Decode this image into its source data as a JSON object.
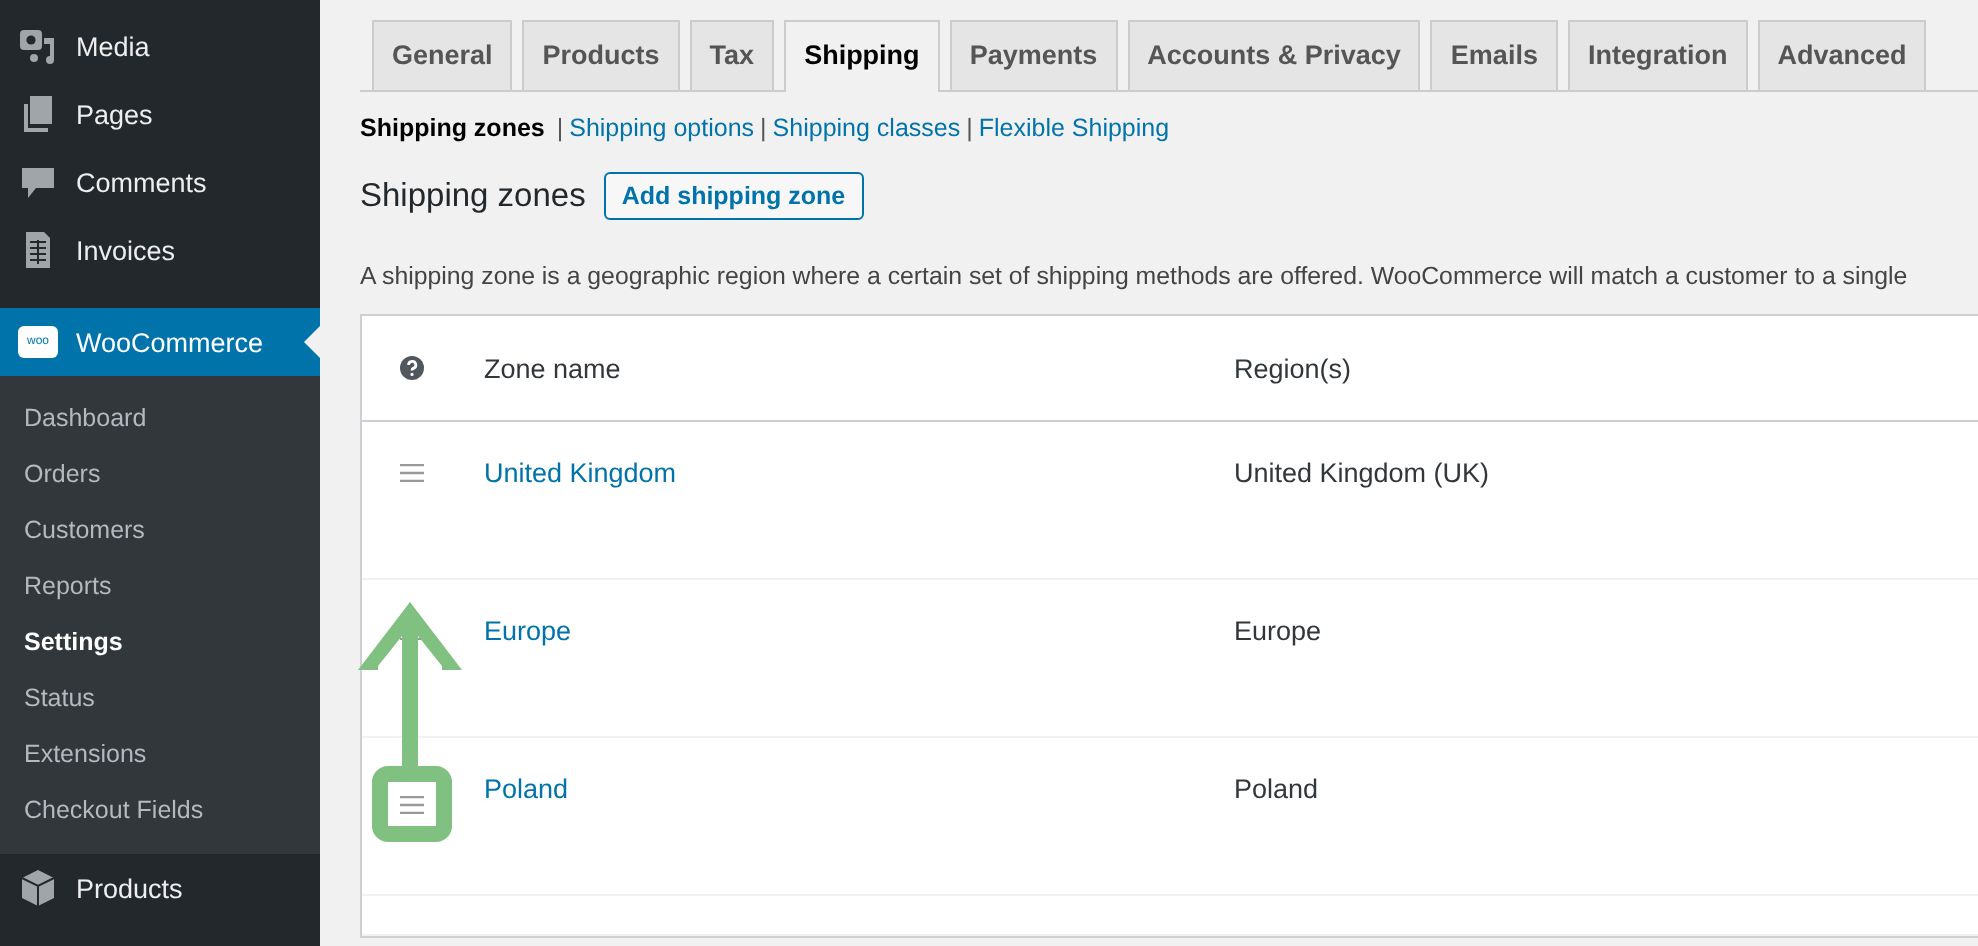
{
  "sidebar": {
    "items": [
      {
        "label": "Media",
        "kind": "media",
        "selected": false
      },
      {
        "label": "Pages",
        "kind": "pages",
        "selected": false
      },
      {
        "label": "Comments",
        "kind": "comments",
        "selected": false
      },
      {
        "label": "Invoices",
        "kind": "invoices",
        "selected": false
      },
      {
        "label": "WooCommerce",
        "kind": "woo",
        "selected": true,
        "badge": "woo",
        "submenu": [
          {
            "label": "Dashboard",
            "selected": false
          },
          {
            "label": "Orders",
            "selected": false
          },
          {
            "label": "Customers",
            "selected": false
          },
          {
            "label": "Reports",
            "selected": false
          },
          {
            "label": "Settings",
            "selected": true
          },
          {
            "label": "Status",
            "selected": false
          },
          {
            "label": "Extensions",
            "selected": false
          },
          {
            "label": "Checkout Fields",
            "selected": false
          }
        ]
      },
      {
        "label": "Products",
        "kind": "products",
        "selected": false
      }
    ]
  },
  "tabs": [
    {
      "label": "General",
      "selected": false
    },
    {
      "label": "Products",
      "selected": false
    },
    {
      "label": "Tax",
      "selected": false
    },
    {
      "label": "Shipping",
      "selected": true
    },
    {
      "label": "Payments",
      "selected": false
    },
    {
      "label": "Accounts & Privacy",
      "selected": false
    },
    {
      "label": "Emails",
      "selected": false
    },
    {
      "label": "Integration",
      "selected": false
    },
    {
      "label": "Advanced",
      "selected": false
    }
  ],
  "subnav": [
    {
      "label": "Shipping zones",
      "selected": true
    },
    {
      "separator": "|",
      "label": "Shipping options",
      "selected": false
    },
    {
      "separator": "|",
      "label": "Shipping classes",
      "selected": false
    },
    {
      "separator": "|",
      "label": "Flexible Shipping",
      "selected": false
    }
  ],
  "heading": "Shipping zones",
  "add_button": "Add shipping zone",
  "description": "A shipping zone is a geographic region where a certain set of shipping methods are offered. WooCommerce will match a customer to a single",
  "table": {
    "columns": [
      "Zone name",
      "Region(s)"
    ],
    "rows": [
      {
        "zone": "United Kingdom",
        "region": "United Kingdom (UK)",
        "highlighted": false
      },
      {
        "zone": "Europe",
        "region": "Europe",
        "highlighted": false
      },
      {
        "zone": "Poland",
        "region": "Poland",
        "highlighted": true
      }
    ]
  },
  "annotation": {
    "kind": "arrow",
    "color": "#80c080"
  }
}
